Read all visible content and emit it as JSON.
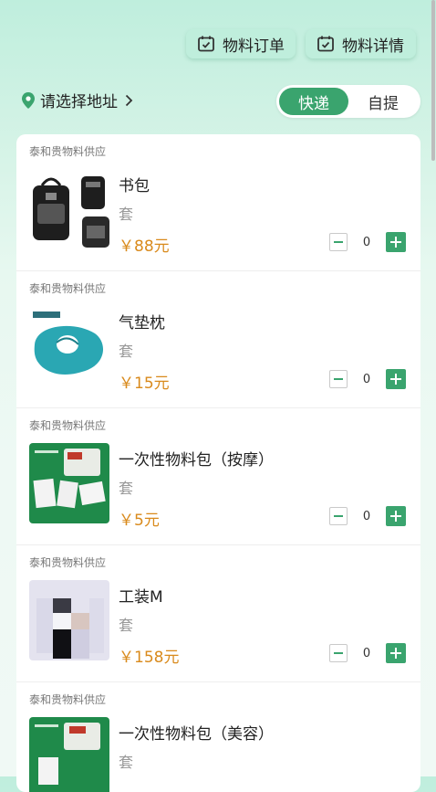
{
  "header": {
    "orders_label": "物料订单",
    "details_label": "物料详情"
  },
  "address": {
    "label": "请选择地址"
  },
  "delivery_toggle": {
    "express": "快递",
    "pickup": "自提",
    "selected": "快递"
  },
  "products": [
    {
      "supplier": "泰和贵物料供应",
      "name": "书包",
      "unit": "套",
      "price": "￥88元",
      "qty": "0",
      "image": "backpack"
    },
    {
      "supplier": "泰和贵物料供应",
      "name": "气垫枕",
      "unit": "套",
      "price": "￥15元",
      "qty": "0",
      "image": "neck-pillow"
    },
    {
      "supplier": "泰和贵物料供应",
      "name": "一次性物料包（按摩）",
      "unit": "套",
      "price": "￥5元",
      "qty": "0",
      "image": "disposable-kit"
    },
    {
      "supplier": "泰和贵物料供应",
      "name": "工装M",
      "unit": "套",
      "price": "￥158元",
      "qty": "0",
      "image": "uniform"
    },
    {
      "supplier": "泰和贵物料供应",
      "name": "一次性物料包（美容）",
      "unit": "套",
      "price": "",
      "qty": "",
      "image": "disposable-kit"
    }
  ],
  "colors": {
    "accent": "#3aa46e",
    "price": "#d98a1c"
  }
}
